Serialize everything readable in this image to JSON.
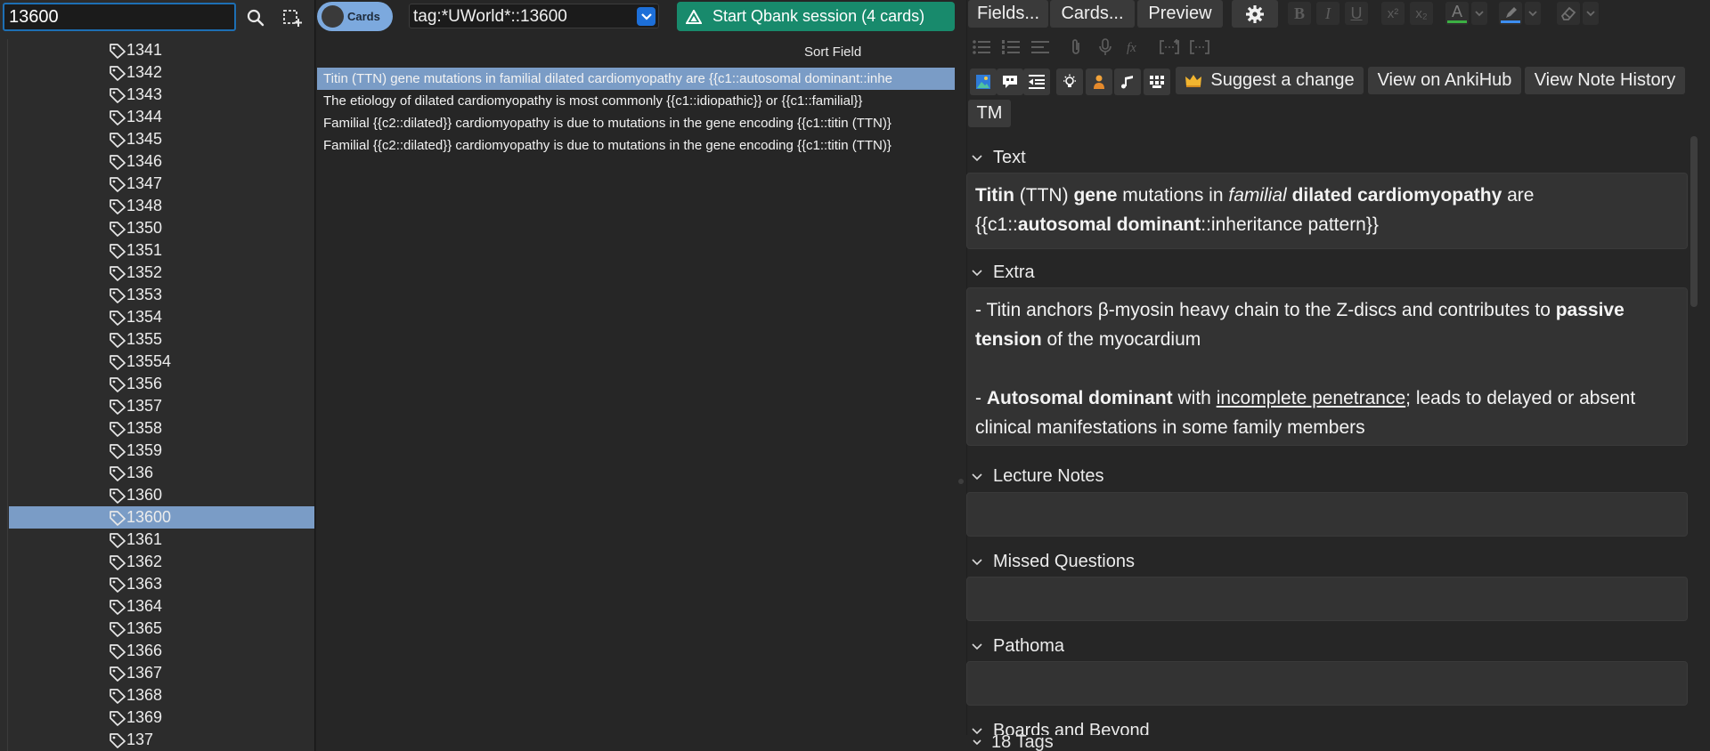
{
  "search": {
    "value": "13600"
  },
  "tags": [
    {
      "label": "1341",
      "selected": false
    },
    {
      "label": "1342",
      "selected": false
    },
    {
      "label": "1343",
      "selected": false
    },
    {
      "label": "1344",
      "selected": false
    },
    {
      "label": "1345",
      "selected": false
    },
    {
      "label": "1346",
      "selected": false
    },
    {
      "label": "1347",
      "selected": false
    },
    {
      "label": "1348",
      "selected": false
    },
    {
      "label": "1350",
      "selected": false
    },
    {
      "label": "1351",
      "selected": false
    },
    {
      "label": "1352",
      "selected": false
    },
    {
      "label": "1353",
      "selected": false
    },
    {
      "label": "1354",
      "selected": false
    },
    {
      "label": "1355",
      "selected": false
    },
    {
      "label": "13554",
      "selected": false
    },
    {
      "label": "1356",
      "selected": false
    },
    {
      "label": "1357",
      "selected": false
    },
    {
      "label": "1358",
      "selected": false
    },
    {
      "label": "1359",
      "selected": false
    },
    {
      "label": "136",
      "selected": false
    },
    {
      "label": "1360",
      "selected": false
    },
    {
      "label": "13600",
      "selected": true
    },
    {
      "label": "1361",
      "selected": false
    },
    {
      "label": "1362",
      "selected": false
    },
    {
      "label": "1363",
      "selected": false
    },
    {
      "label": "1364",
      "selected": false
    },
    {
      "label": "1365",
      "selected": false
    },
    {
      "label": "1366",
      "selected": false
    },
    {
      "label": "1367",
      "selected": false
    },
    {
      "label": "1368",
      "selected": false
    },
    {
      "label": "1369",
      "selected": false
    },
    {
      "label": "137",
      "selected": false
    }
  ],
  "toolbar": {
    "toggle_label": "Cards",
    "query": "tag:*UWorld*::13600",
    "qbank_label": "Start Qbank session (4 cards)"
  },
  "table": {
    "header": "Sort Field",
    "rows": [
      {
        "text": "Titin (TTN) gene mutations in familial dilated cardiomyopathy are {{c1::autosomal dominant::inhe",
        "selected": true
      },
      {
        "text": "The etiology of dilated cardiomyopathy is most commonly {{c1::idiopathic}} or {{c1::familial}}",
        "selected": false
      },
      {
        "text": "Familial {{c2::dilated}} cardiomyopathy is due to mutations in the gene encoding {{c1::titin (TTN)}",
        "selected": false
      },
      {
        "text": "Familial {{c2::dilated}} cardiomyopathy is due to mutations in the gene encoding {{c1::titin (TTN)}",
        "selected": false
      }
    ]
  },
  "editor": {
    "fields_btn": "Fields...",
    "cards_btn": "Cards...",
    "preview_btn": "Preview",
    "format_bold": "B",
    "format_italic": "I",
    "format_underline": "U",
    "format_superscript": "x²",
    "format_subscript": "x₂",
    "font_color_letter": "A",
    "font_color": "#3cb043",
    "highlight_color": "#3d8ef0",
    "suggest_label": "Suggest a change",
    "ankihub_label": "View on AnkiHub",
    "history_label": "View Note History",
    "tm_label": "TM",
    "fields": {
      "text_label": "Text",
      "text_line1": {
        "b1": "Titin",
        "t1": " (TTN) ",
        "b2": "gene",
        "t2": " mutations in ",
        "i1": "familial",
        "t3": " ",
        "b3": "dilated cardiomyopathy",
        "t4": " are"
      },
      "text_line2": {
        "t1": "{{c1::",
        "b1": "autosomal dominant",
        "t2": "::inheritance pattern}}"
      },
      "extra_label": "Extra",
      "extra_p1": {
        "t1": "- Titin anchors β-myosin heavy chain to the Z-discs and contributes to ",
        "b1": "passive",
        "b2": "tension",
        "t2": " of the myocardium"
      },
      "extra_p2": {
        "t1": "- ",
        "b1": "Autosomal dominant",
        "t2": " with ",
        "u1": "incomplete penetrance",
        "t3": "; leads to delayed or absent clinical manifestations in some family members"
      },
      "lecture_label": "Lecture Notes",
      "missed_label": "Missed Questions",
      "pathoma_label": "Pathoma",
      "boards_label": "Boards and Beyond"
    },
    "tags_count_label": "18 Tags"
  }
}
